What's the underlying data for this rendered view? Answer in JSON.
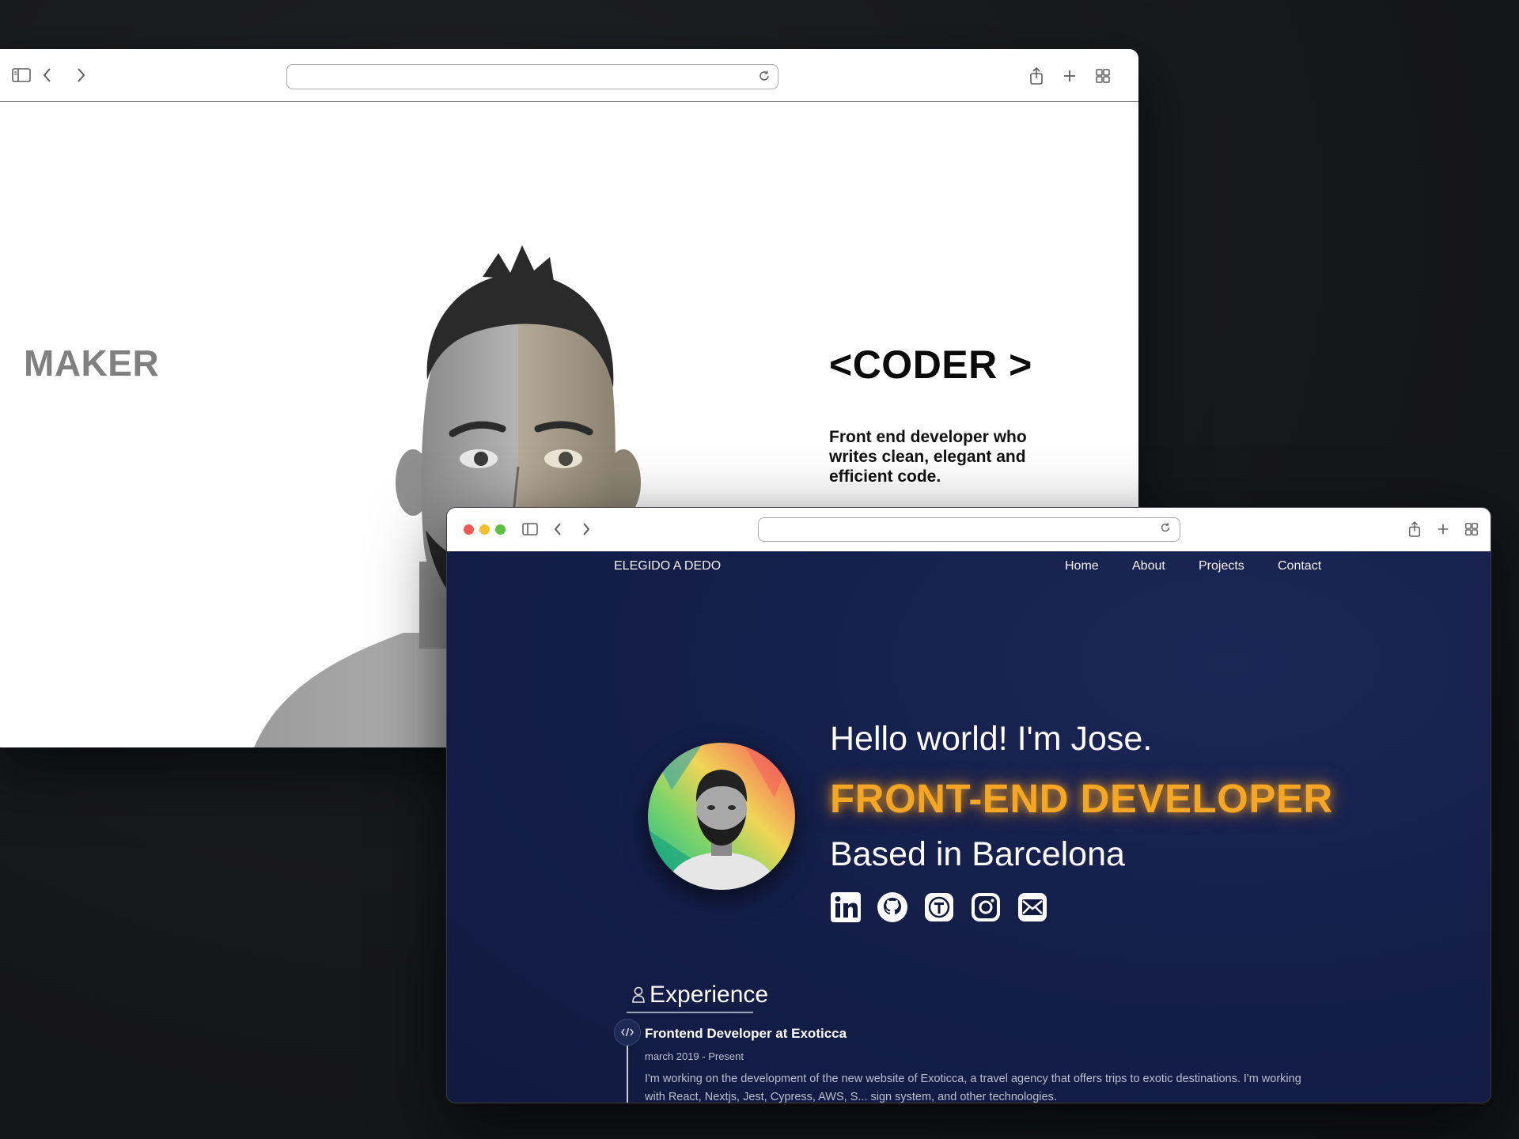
{
  "back_window": {
    "address_value": "",
    "maker_label": "MAKER",
    "coder_label": "<CODER >",
    "coder_description": "Front end developer who writes clean, elegant and efficient code."
  },
  "front_window": {
    "address_value": "",
    "brand": "ELEGIDO A DEDO",
    "nav": [
      "Home",
      "About",
      "Projects",
      "Contact"
    ],
    "hero": {
      "greeting": "Hello world! I'm Jose.",
      "role": "FRONT-END DEVELOPER",
      "location": "Based in Barcelona"
    },
    "social_icons": [
      "linkedin-icon",
      "github-icon",
      "tiktok-icon",
      "instagram-icon",
      "mail-icon"
    ],
    "experience": {
      "heading": "Experience",
      "jobs": [
        {
          "title": "Frontend Developer at Exoticca",
          "dates": "march 2019 - Present",
          "description": "I'm working on the development of the new website of Exoticca, a travel agency that offers trips to exotic destinations. I'm working with React, Nextjs, Jest, Cypress, AWS, S... sign system, and other technologies."
        }
      ]
    }
  },
  "colors": {
    "accent": "#f5a623",
    "site_background": "#141f4a",
    "traffic_red": "#ee5a52",
    "traffic_yellow": "#f5be2f",
    "traffic_green": "#5bc13e"
  }
}
